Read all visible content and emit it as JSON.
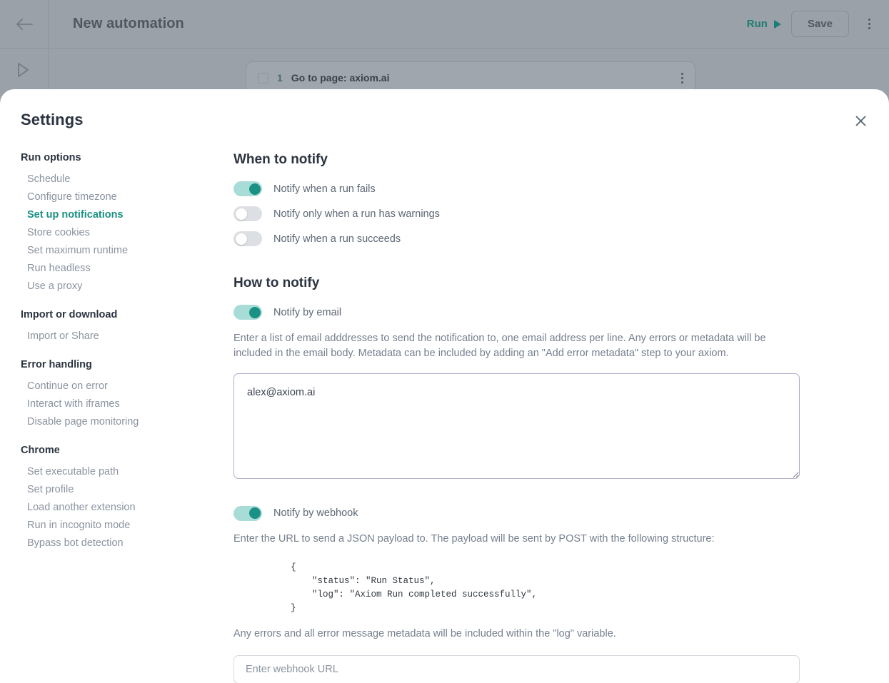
{
  "background_app": {
    "back_icon": "back-arrow-icon",
    "title": "New automation",
    "run_label": "Run",
    "save_label": "Save",
    "kebab_icon": "more-options-icon",
    "rail_play_icon": "play-icon",
    "step": {
      "number": "1",
      "label": "Go to page: axiom.ai",
      "checkbox_icon": "checkbox-unchecked-icon",
      "kebab_icon": "more-options-icon"
    }
  },
  "modal": {
    "title": "Settings",
    "close_icon": "close-icon"
  },
  "sidebar": {
    "groups": [
      {
        "title": "Run options",
        "items": [
          {
            "label": "Schedule",
            "active": false
          },
          {
            "label": "Configure timezone",
            "active": false
          },
          {
            "label": "Set up notifications",
            "active": true
          },
          {
            "label": "Store cookies",
            "active": false
          },
          {
            "label": "Set maximum runtime",
            "active": false
          },
          {
            "label": "Run headless",
            "active": false
          },
          {
            "label": "Use a proxy",
            "active": false
          }
        ]
      },
      {
        "title": "Import or download",
        "items": [
          {
            "label": "Import or Share",
            "active": false
          }
        ]
      },
      {
        "title": "Error handling",
        "items": [
          {
            "label": "Continue on error",
            "active": false
          },
          {
            "label": "Interact with iframes",
            "active": false
          },
          {
            "label": "Disable page monitoring",
            "active": false
          }
        ]
      },
      {
        "title": "Chrome",
        "items": [
          {
            "label": "Set executable path",
            "active": false
          },
          {
            "label": "Set profile",
            "active": false
          },
          {
            "label": "Load another extension",
            "active": false
          },
          {
            "label": "Run in incognito mode",
            "active": false
          },
          {
            "label": "Bypass bot detection",
            "active": false
          }
        ]
      }
    ]
  },
  "when_to_notify": {
    "heading": "When to notify",
    "toggles": [
      {
        "label": "Notify when a run fails",
        "on": true
      },
      {
        "label": "Notify only when a run has warnings",
        "on": false
      },
      {
        "label": "Notify when a run succeeds",
        "on": false
      }
    ]
  },
  "how_to_notify": {
    "heading": "How to notify",
    "email": {
      "toggle_label": "Notify by email",
      "toggle_on": true,
      "helper": "Enter a list of email adddresses to send the notification to, one email address per line. Any errors or metadata will be included in the email body. Metadata can be included by adding an \"Add error metadata\" step to your axiom.",
      "value": "alex@axiom.ai",
      "placeholder": ""
    },
    "webhook": {
      "toggle_label": "Notify by webhook",
      "toggle_on": true,
      "helper": "Enter the URL to send a JSON payload to. The payload will be sent by POST with the following structure:",
      "code": "{\n    \"status\": \"Run Status\",\n    \"log\": \"Axiom Run completed successfully\",\n}",
      "footer": "Any errors and all error message metadata will be included within the \"log\" variable.",
      "placeholder": "Enter webhook URL",
      "value": ""
    }
  },
  "colors": {
    "accent_teal": "#1a9184",
    "toggle_on_track": "#a8dcd7",
    "toggle_off_track": "#dcdfe3",
    "heading": "#2b3440",
    "body_text": "#76808f",
    "backdrop": "#9aa1a9"
  }
}
